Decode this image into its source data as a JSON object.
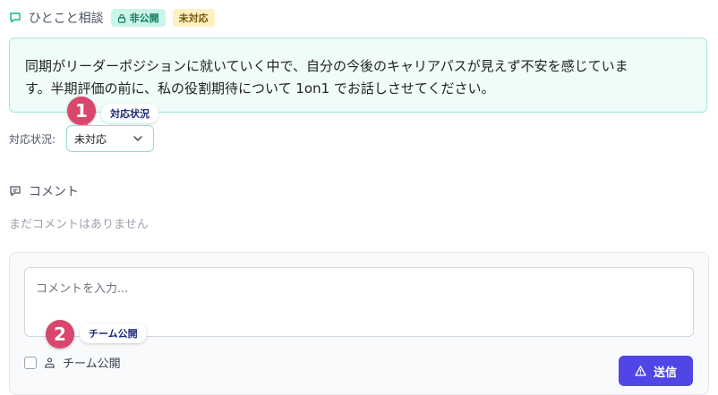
{
  "header": {
    "title": "ひとこと相談",
    "private_badge": "非公開",
    "status_badge": "未対応"
  },
  "message": {
    "line1": "同期がリーダーポジションに就いていく中で、自分の今後のキャリアパスが見えず不安を感じていま",
    "line2": "す。半期評価の前に、私の役割期待について 1on1 でお話しさせてください。"
  },
  "annotations": [
    {
      "number": "1",
      "label": "対応状況"
    },
    {
      "number": "2",
      "label": "チーム公開"
    }
  ],
  "status": {
    "label": "対応状況:",
    "selected": "未対応"
  },
  "comments": {
    "title": "コメント",
    "empty_text": "まだコメントはありません",
    "input_placeholder": "コメントを入力...",
    "team_public_label": "チーム公開",
    "send_label": "送信"
  },
  "colors": {
    "accent": "#4f46e5",
    "teal_border": "#9fe6d5",
    "marker": "#d9466e"
  }
}
